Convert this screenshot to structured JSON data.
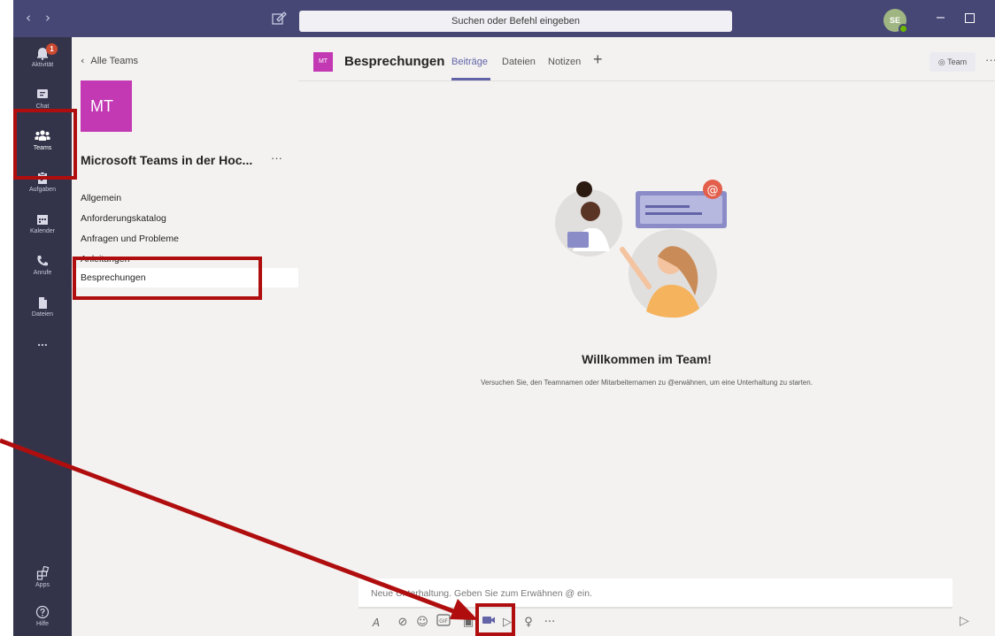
{
  "titlebar": {
    "back_icon": "chevron-left-icon",
    "forward_icon": "chevron-right-icon",
    "new_chat_icon": "compose-icon",
    "search_placeholder": "Suchen oder Befehl eingeben",
    "avatar_initials": "SE",
    "minimize": "–",
    "close": "×"
  },
  "rail": {
    "items": [
      {
        "label": "Aktivität",
        "icon": "bell-icon",
        "badge": "1"
      },
      {
        "label": "Chat",
        "icon": "chat-icon"
      },
      {
        "label": "Teams",
        "icon": "teams-icon"
      },
      {
        "label": "Aufgaben",
        "icon": "tasks-icon"
      },
      {
        "label": "Kalender",
        "icon": "calendar-icon"
      },
      {
        "label": "Anrufe",
        "icon": "phone-icon"
      },
      {
        "label": "Dateien",
        "icon": "file-icon"
      }
    ],
    "more": "...",
    "apps_label": "Apps",
    "help_label": "Hilfe"
  },
  "teampanel": {
    "back_label": "Alle Teams",
    "team_initials": "MT",
    "team_name": "Microsoft Teams in der Hoc...",
    "more": "···",
    "channels": [
      "Allgemein",
      "Anforderungskatalog",
      "Anfragen und Probleme",
      "Anleitungen",
      "Besprechungen"
    ]
  },
  "channel": {
    "avatar_initials": "MT",
    "title": "Besprechungen",
    "tabs": [
      "Beiträge",
      "Dateien",
      "Notizen"
    ],
    "add_tab": "+",
    "team_button": "Team",
    "more": "···"
  },
  "welcome": {
    "title": "Willkommen im Team!",
    "text": "Versuchen Sie, den Teamnamen oder Mitarbeiternamen zu @erwähnen, um eine Unterhaltung zu starten."
  },
  "composer": {
    "placeholder": "Neue Unterhaltung. Geben Sie zum Erwähnen @ ein.",
    "tools": [
      "format-icon",
      "attach-icon",
      "emoji-icon",
      "gif-icon",
      "sticker-icon",
      "meet-now-icon",
      "stream-icon",
      "praise-icon",
      "more-icon"
    ],
    "more_glyph": "···",
    "send_icon": "send-icon"
  },
  "colors": {
    "titlebar": "#464775",
    "rail": "#33344a",
    "accent": "#6264a7",
    "team_color": "#c239b3",
    "annotation": "#b00e0e"
  }
}
